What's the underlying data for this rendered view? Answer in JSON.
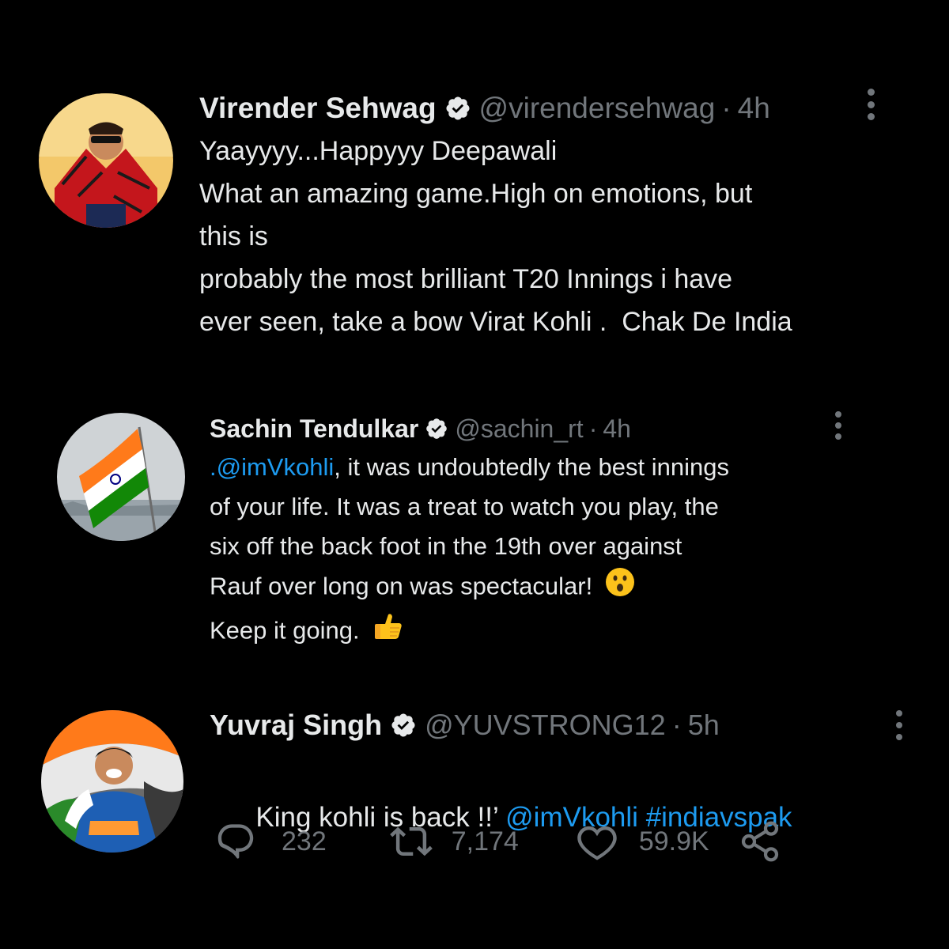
{
  "tweets": [
    {
      "name": "Virender Sehwag",
      "handle": "@virendersehwag",
      "dot": "·",
      "time": "4h",
      "lines": [
        "Yaayyyy...Happyyy Deepawali",
        "What an amazing game.High on emotions, but",
        "this is",
        "probably the most brilliant T20 Innings i have",
        "ever seen, take a bow Virat Kohli .  Chak De India"
      ]
    },
    {
      "name": "Sachin Tendulkar",
      "handle": "@sachin_rt",
      "dot": "·",
      "time": "4h",
      "mention": ".@imVkohli",
      "line1_rest": ", it was undoubtedly the best innings",
      "lines": [
        "of your life. It was a treat to watch you play, the",
        "six off the back foot in the 19th over against",
        "Rauf over long on was spectacular!",
        "Keep it going."
      ]
    },
    {
      "name": "Yuvraj Singh",
      "handle": "@YUVSTRONG12",
      "dot": "·",
      "time": "5h",
      "text": "King kohli is back !!’ ",
      "mention": "@imVkohli",
      "hashtag": "#indiavspak",
      "replies": "232",
      "retweets": "7,174",
      "likes": "59.9K"
    }
  ],
  "colors": {
    "background": "#000000",
    "text": "#e7e9ea",
    "muted": "#71767b",
    "link": "#1d9bf0"
  },
  "icons": [
    "verified-badge-icon",
    "more-options-icon",
    "reply-icon",
    "retweet-icon",
    "like-icon",
    "share-icon",
    "face-with-open-mouth-emoji",
    "thumbs-up-emoji"
  ]
}
